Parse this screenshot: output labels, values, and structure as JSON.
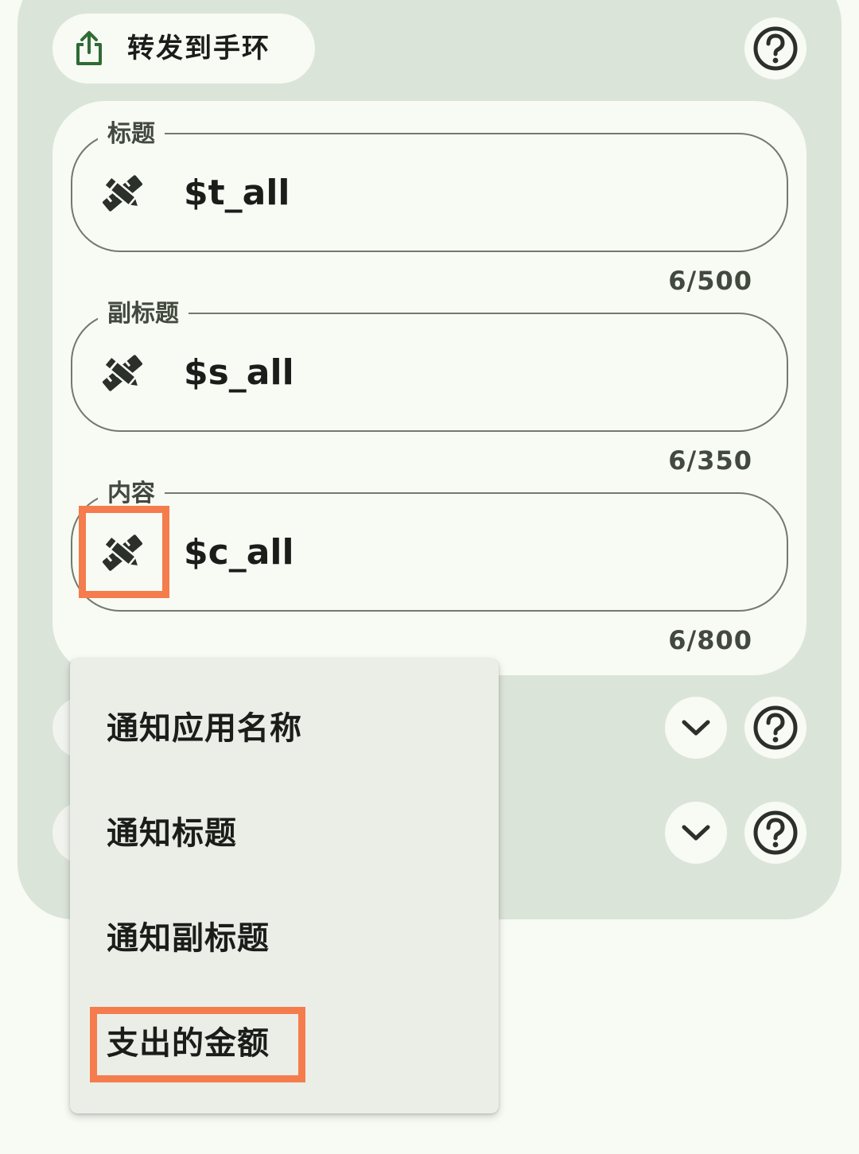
{
  "forward": {
    "label": "转发到手环"
  },
  "fields": [
    {
      "label": "标题",
      "value": "$t_all",
      "counter": "6/500"
    },
    {
      "label": "副标题",
      "value": "$s_all",
      "counter": "6/350"
    },
    {
      "label": "内容",
      "value": "$c_all",
      "counter": "6/800"
    }
  ],
  "menu": {
    "items": [
      {
        "label": "通知应用名称"
      },
      {
        "label": "通知标题"
      },
      {
        "label": "通知副标题"
      },
      {
        "label": "支出的金额"
      }
    ]
  },
  "icons": {
    "share": "share-icon",
    "help": "help-circle-icon",
    "field_tool": "pencil-ruler-icon",
    "dropdown": "chevron-down-icon"
  },
  "colors": {
    "outer_card": "#dbe4d9",
    "surface": "#f8faf4",
    "menu": "#ebeee7",
    "highlight": "#f57c4c",
    "outline": "#727970",
    "icon_green": "#2f6b35"
  }
}
